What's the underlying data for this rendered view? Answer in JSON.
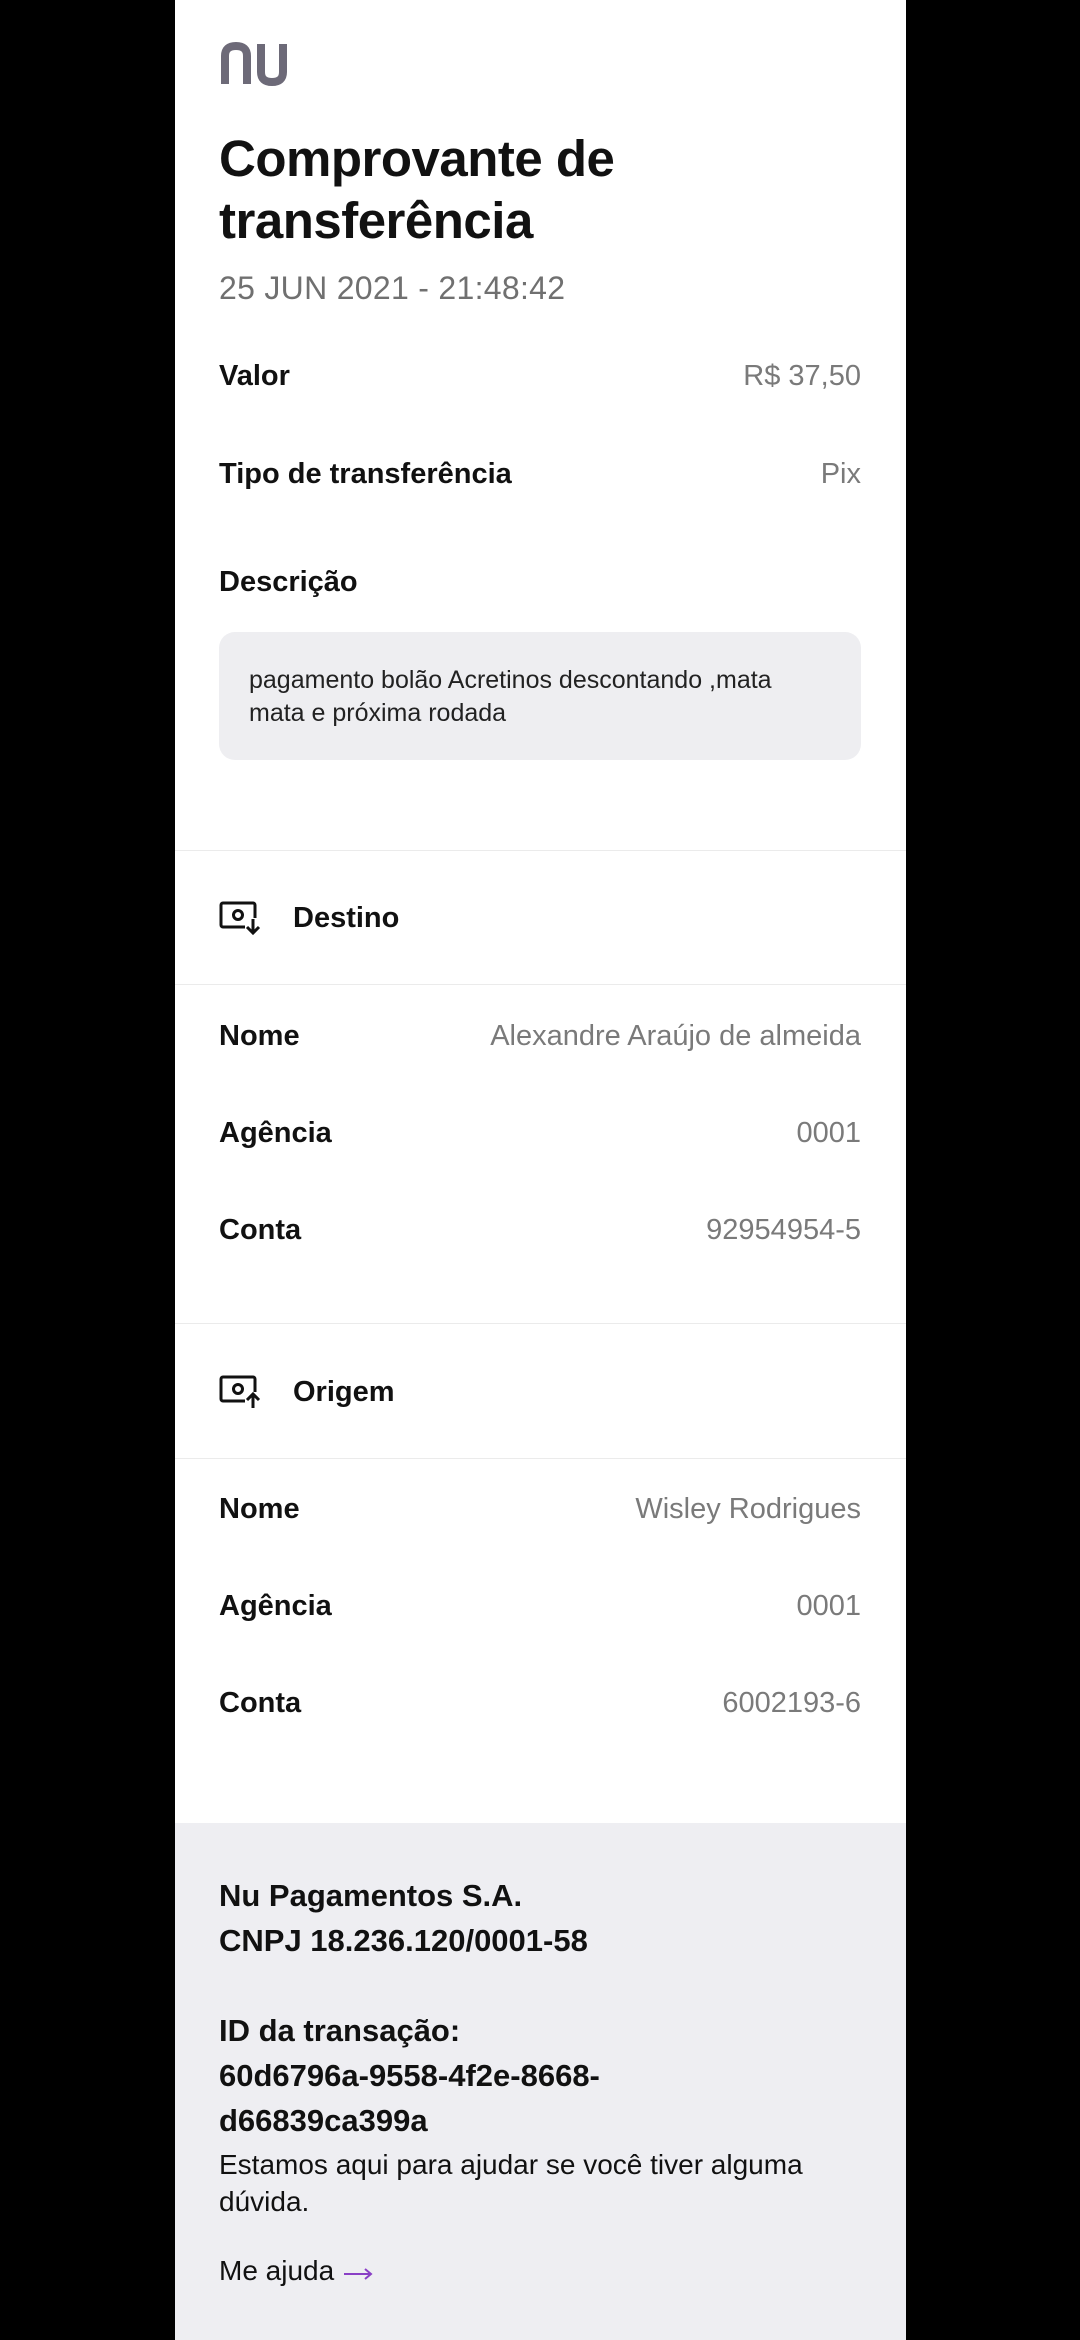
{
  "brand": {
    "logo": "nu",
    "accent": "#820AD1"
  },
  "header": {
    "title": "Comprovante de transferência",
    "timestamp": "25 JUN 2021 - 21:48:42"
  },
  "summary": {
    "valor_label": "Valor",
    "valor_value": "R$ 37,50",
    "tipo_label": "Tipo de transferência",
    "tipo_value": "Pix",
    "descricao_label": "Descrição",
    "descricao_text": "pagamento bolão Acretinos descontando ,mata mata e próxima rodada"
  },
  "destino": {
    "title": "Destino",
    "icon": "money-in-icon",
    "nome_label": "Nome",
    "nome_value": "Alexandre Araújo de almeida",
    "agencia_label": "Agência",
    "agencia_value": "0001",
    "conta_label": "Conta",
    "conta_value": "92954954-5"
  },
  "origem": {
    "title": "Origem",
    "icon": "money-out-icon",
    "nome_label": "Nome",
    "nome_value": "Wisley Rodrigues",
    "agencia_label": "Agência",
    "agencia_value": "0001",
    "conta_label": "Conta",
    "conta_value": "6002193-6"
  },
  "footer": {
    "company": "Nu Pagamentos S.A.",
    "cnpj": "CNPJ 18.236.120/0001-58",
    "transaction_label": "ID da transação:",
    "transaction_id_1": "60d6796a-9558-4f2e-8668-",
    "transaction_id_2": "d66839ca399a",
    "help_text": "Estamos aqui para ajudar se você tiver alguma dúvida.",
    "help_link": "Me ajuda"
  }
}
